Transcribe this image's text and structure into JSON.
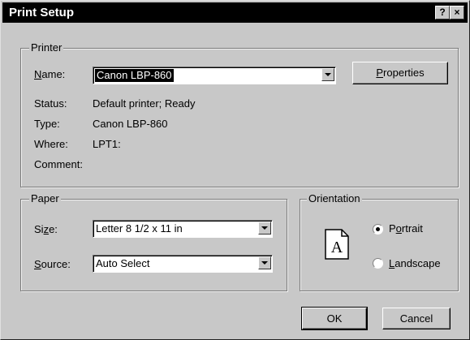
{
  "dialog": {
    "title": "Print Setup",
    "help_button": "?",
    "close_button": "×"
  },
  "printer": {
    "group_label": "Printer",
    "name_label": "Name:",
    "name_value": "Canon LBP-860",
    "properties_button": "Properties",
    "status_label": "Status:",
    "status_value": "Default printer; Ready",
    "type_label": "Type:",
    "type_value": "Canon LBP-860",
    "where_label": "Where:",
    "where_value": "LPT1:",
    "comment_label": "Comment:",
    "comment_value": ""
  },
  "paper": {
    "group_label": "Paper",
    "size_label": "Size:",
    "size_value": "Letter 8 1/2 x 11 in",
    "source_label": "Source:",
    "source_value": "Auto Select"
  },
  "orientation": {
    "group_label": "Orientation",
    "preview_letter": "A",
    "portrait_label": "Portrait",
    "landscape_label": "Landscape",
    "selected": "Portrait"
  },
  "buttons": {
    "ok": "OK",
    "cancel": "Cancel"
  }
}
